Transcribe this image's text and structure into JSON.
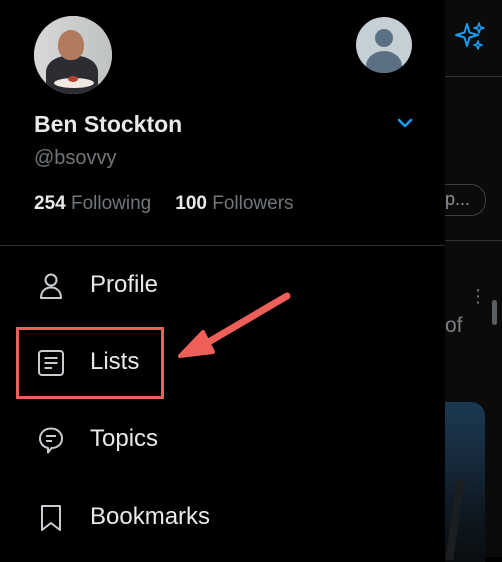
{
  "profile": {
    "name": "Ben Stockton",
    "handle": "@bsovvy",
    "following_count": "254",
    "following_label": "Following",
    "followers_count": "100",
    "followers_label": "Followers"
  },
  "menu": [
    {
      "label": "Profile",
      "icon": "person-icon"
    },
    {
      "label": "Lists",
      "icon": "list-icon"
    },
    {
      "label": "Topics",
      "icon": "topic-icon"
    },
    {
      "label": "Bookmarks",
      "icon": "bookmark-icon"
    }
  ],
  "background_peek": {
    "pill_text": "p...",
    "dots": "⋮",
    "text_fragment": "of"
  },
  "colors": {
    "accent": "#1d9bf0",
    "highlight": "#ef5f5a",
    "background": "#000000",
    "text": "#e7e9ea",
    "muted": "#71767b"
  }
}
